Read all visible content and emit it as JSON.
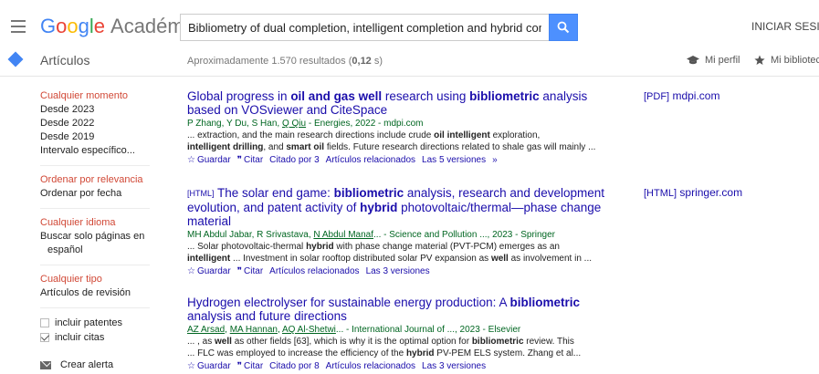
{
  "header": {
    "logo_google": [
      "G",
      "o",
      "o",
      "g",
      "l",
      "e"
    ],
    "logo_product": "Académico",
    "search_value": "Bibliometry of dual completion, intelligent completion and hybrid completion ir",
    "signin": "INICIAR SESIÓN"
  },
  "subbar": {
    "articles": "Artículos",
    "stats_prefix": "Aproximadamente 1.570 resultados (",
    "stats_time": "0,12",
    "stats_suffix": " s)",
    "profile": "Mi perfil",
    "library": "Mi biblioteca"
  },
  "sidebar": {
    "time": [
      "Cualquier momento",
      "Desde 2023",
      "Desde 2022",
      "Desde 2019",
      "Intervalo específico..."
    ],
    "sort": [
      "Ordenar por relevancia",
      "Ordenar por fecha"
    ],
    "lang": [
      "Cualquier idioma",
      "Buscar solo páginas en",
      "español"
    ],
    "type": [
      "Cualquier tipo",
      "Artículos de revisión"
    ],
    "include_patents": "incluir patentes",
    "include_citations": "incluir citas",
    "alert": "Crear alerta"
  },
  "results": [
    {
      "title_parts": [
        "Global progress in ",
        "oil and gas well",
        " research using ",
        "bibliometric",
        " analysis based on VOSviewer and CiteSpace"
      ],
      "authors_plain": "P Zhang, Y Du, S Han, ",
      "authors_link": "Q Qiu",
      "source": " - Energies, 2022 - mdpi.com",
      "snippet1_parts": [
        "... extraction, and the main research directions include crude ",
        "oil intelligent",
        " exploration,"
      ],
      "snippet2_parts": [
        "intelligent drilling",
        ", and ",
        "smart oil",
        " fields. Future research directions related to shale gas will mainly ..."
      ],
      "actions": [
        "Guardar",
        "Citar",
        "Citado por 3",
        "Artículos relacionados",
        "Las 5 versiones"
      ],
      "side_fmt": "[PDF]",
      "side_site": " mdpi.com"
    },
    {
      "tag": "[HTML]",
      "title_parts": [
        " The solar end game: ",
        "bibliometric",
        " analysis, research and development evolution, and patent activity of ",
        "hybrid",
        " photovoltaic/thermal—phase change material"
      ],
      "authors_plain": "MH Abdul Jabar, R Srivastava, ",
      "authors_link": "N Abdul Manaf",
      "source": "... - Science and Pollution ..., 2023 - Springer",
      "snippet1_parts": [
        "... Solar photovoltaic-thermal ",
        "hybrid",
        " with phase change material (PVT-PCM) emerges as an"
      ],
      "snippet2_parts": [
        "intelligent",
        " ... Investment in solar rooftop distributed solar PV expansion as ",
        "well",
        " as involvement in ..."
      ],
      "actions": [
        "Guardar",
        "Citar",
        "Artículos relacionados",
        "Las 3 versiones"
      ],
      "side_fmt": "[HTML]",
      "side_site": " springer.com"
    },
    {
      "title_parts": [
        "Hydrogen electrolyser for sustainable energy production: A ",
        "bibliometric",
        " analysis and future directions"
      ],
      "authors_links": [
        "AZ Arsad",
        "MA Hannan",
        "AQ Al-Shetwi"
      ],
      "source": "... - International Journal of ..., 2023 - Elsevier",
      "snippet1_parts": [
        "... , as ",
        "well",
        " as other fields [63], which is why it is the optimal option for ",
        "bibliometric",
        " review. This"
      ],
      "snippet2_parts": [
        "... FLC was employed to increase the efficiency of the ",
        "hybrid",
        " PV-PEM ELS system. Zhang et al..."
      ],
      "actions": [
        "Guardar",
        "Citar",
        "Citado por 8",
        "Artículos relacionados",
        "Las 3 versiones"
      ]
    }
  ],
  "colors": {
    "link": "#1a0dab",
    "accent_red": "#d14836",
    "author_green": "#006621",
    "search_blue": "#4d90fe"
  }
}
